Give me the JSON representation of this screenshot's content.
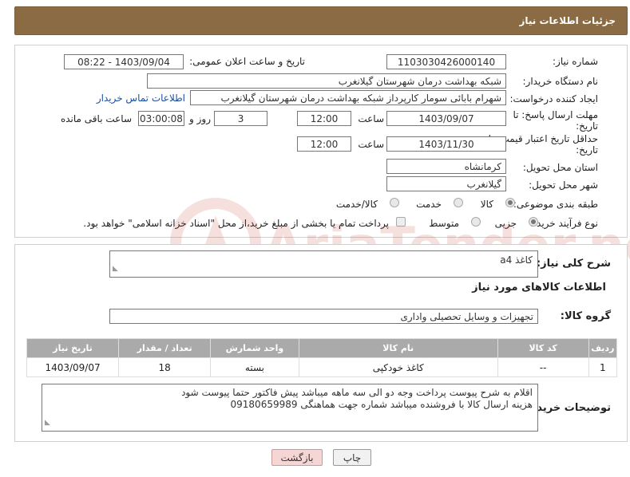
{
  "header": {
    "title": "جزئیات اطلاعات نیاز"
  },
  "form": {
    "need_number": {
      "label": "شماره نیاز:",
      "value": "1103030426000140"
    },
    "announce_datetime": {
      "label": "تاریخ و ساعت اعلان عمومی:",
      "value": "1403/09/04 - 08:22"
    },
    "buyer_org": {
      "label": "نام دستگاه خریدار:",
      "value": "شبکه بهداشت درمان شهرستان گیلانغرب"
    },
    "requester": {
      "label": "ایجاد کننده درخواست:",
      "value": "شهرام بابائی سومار کارپرداز شبکه بهداشت درمان شهرستان گیلانغرب",
      "contact_link": "اطلاعات تماس خریدار"
    },
    "reply_deadline": {
      "label_line1": "مهلت ارسال پاسخ: تا",
      "label_line2": "تاریخ:",
      "date": "1403/09/07",
      "time_label": "ساعت",
      "time": "12:00",
      "days": "3",
      "days_label": "روز و",
      "remaining": "03:00:08",
      "remaining_label": "ساعت باقی مانده"
    },
    "price_validity": {
      "label_line1": "حداقل تاریخ اعتبار قیمت: تا",
      "label_line2": "تاریخ:",
      "date": "1403/11/30",
      "time_label": "ساعت",
      "time": "12:00"
    },
    "province": {
      "label": "استان محل تحویل:",
      "value": "کرمانشاه"
    },
    "city": {
      "label": "شهر محل تحویل:",
      "value": "گیلانغرب"
    },
    "category": {
      "label": "طبقه بندی موضوعی:",
      "options": [
        "کالا",
        "خدمت",
        "کالا/خدمت"
      ],
      "selected": "کالا"
    },
    "purchase_type": {
      "label": "نوع فرآیند خرید :",
      "options": [
        "جزیی",
        "متوسط"
      ],
      "selected": "جزیی",
      "payment_note": "پرداخت تمام یا بخشی از مبلغ خرید،از محل \"اسناد خزانه اسلامی\" خواهد بود."
    }
  },
  "description": {
    "label": "شرح کلی نیاز:",
    "value": "کاغذ a4"
  },
  "goods_section": {
    "title": "اطلاعات کالاهای مورد نیاز",
    "group_label": "گروه کالا:",
    "group_value": "تجهیزات و وسایل تحصیلی واداری",
    "columns": [
      "ردیف",
      "کد کالا",
      "نام کالا",
      "واحد شمارش",
      "تعداد / مقدار",
      "تاریخ نیاز"
    ],
    "rows": [
      {
        "row": "1",
        "code": "--",
        "name": "کاغذ خودکپی",
        "unit": "بسته",
        "qty": "18",
        "date": "1403/09/07"
      }
    ]
  },
  "buyer_notes": {
    "label": "توضیحات خریدار:",
    "line1": "اقلام به شرح پیوست پرداخت وجه دو الی سه ماهه میباشد پیش فاکتور حتما پیوست شود",
    "line2": "هزینه ارسال کالا با فروشنده میباشد شماره جهت هماهنگی 09180659989"
  },
  "buttons": {
    "print": "چاپ",
    "back": "بازگشت"
  },
  "watermark": {
    "text": "AriaTender.neT",
    "color": "#c0392b"
  },
  "colors": {
    "header_bg": "#8b6b44",
    "table_header_bg": "#aaaaaa",
    "back_button_bg": "#f6d5d5"
  }
}
